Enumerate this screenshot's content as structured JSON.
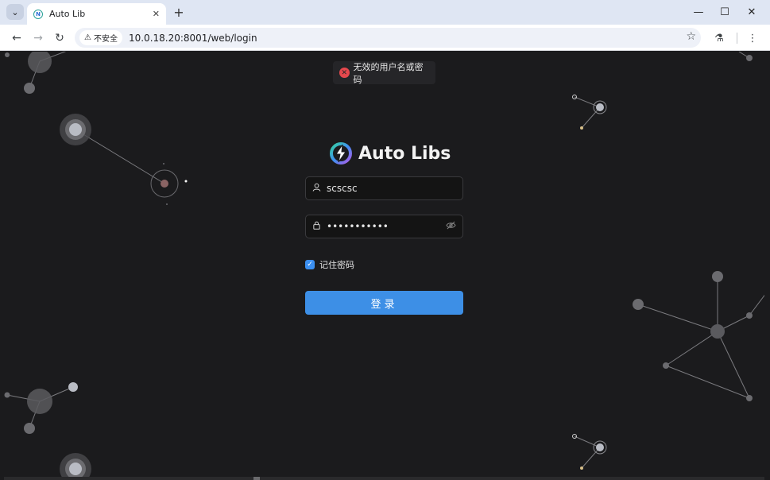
{
  "browser": {
    "tab_title": "Auto Lib",
    "tab_menu_icon": "chevron-down-icon",
    "new_tab_symbol": "+",
    "security_label": "不安全",
    "url": "10.0.18.20:8001/web/login",
    "window_controls": {
      "minimize": "—",
      "maximize": "☐",
      "close": "✕"
    }
  },
  "page": {
    "toast_message": "无效的用户名或密码",
    "brand_name": "Auto Libs",
    "username_value": "scscsc",
    "password_value": "•••••••••••",
    "remember_label": "记住密码",
    "remember_checked": true,
    "login_button_label": "登录"
  },
  "colors": {
    "background": "#1b1b1d",
    "primary": "#3d8fe6",
    "error": "#e5484d"
  }
}
